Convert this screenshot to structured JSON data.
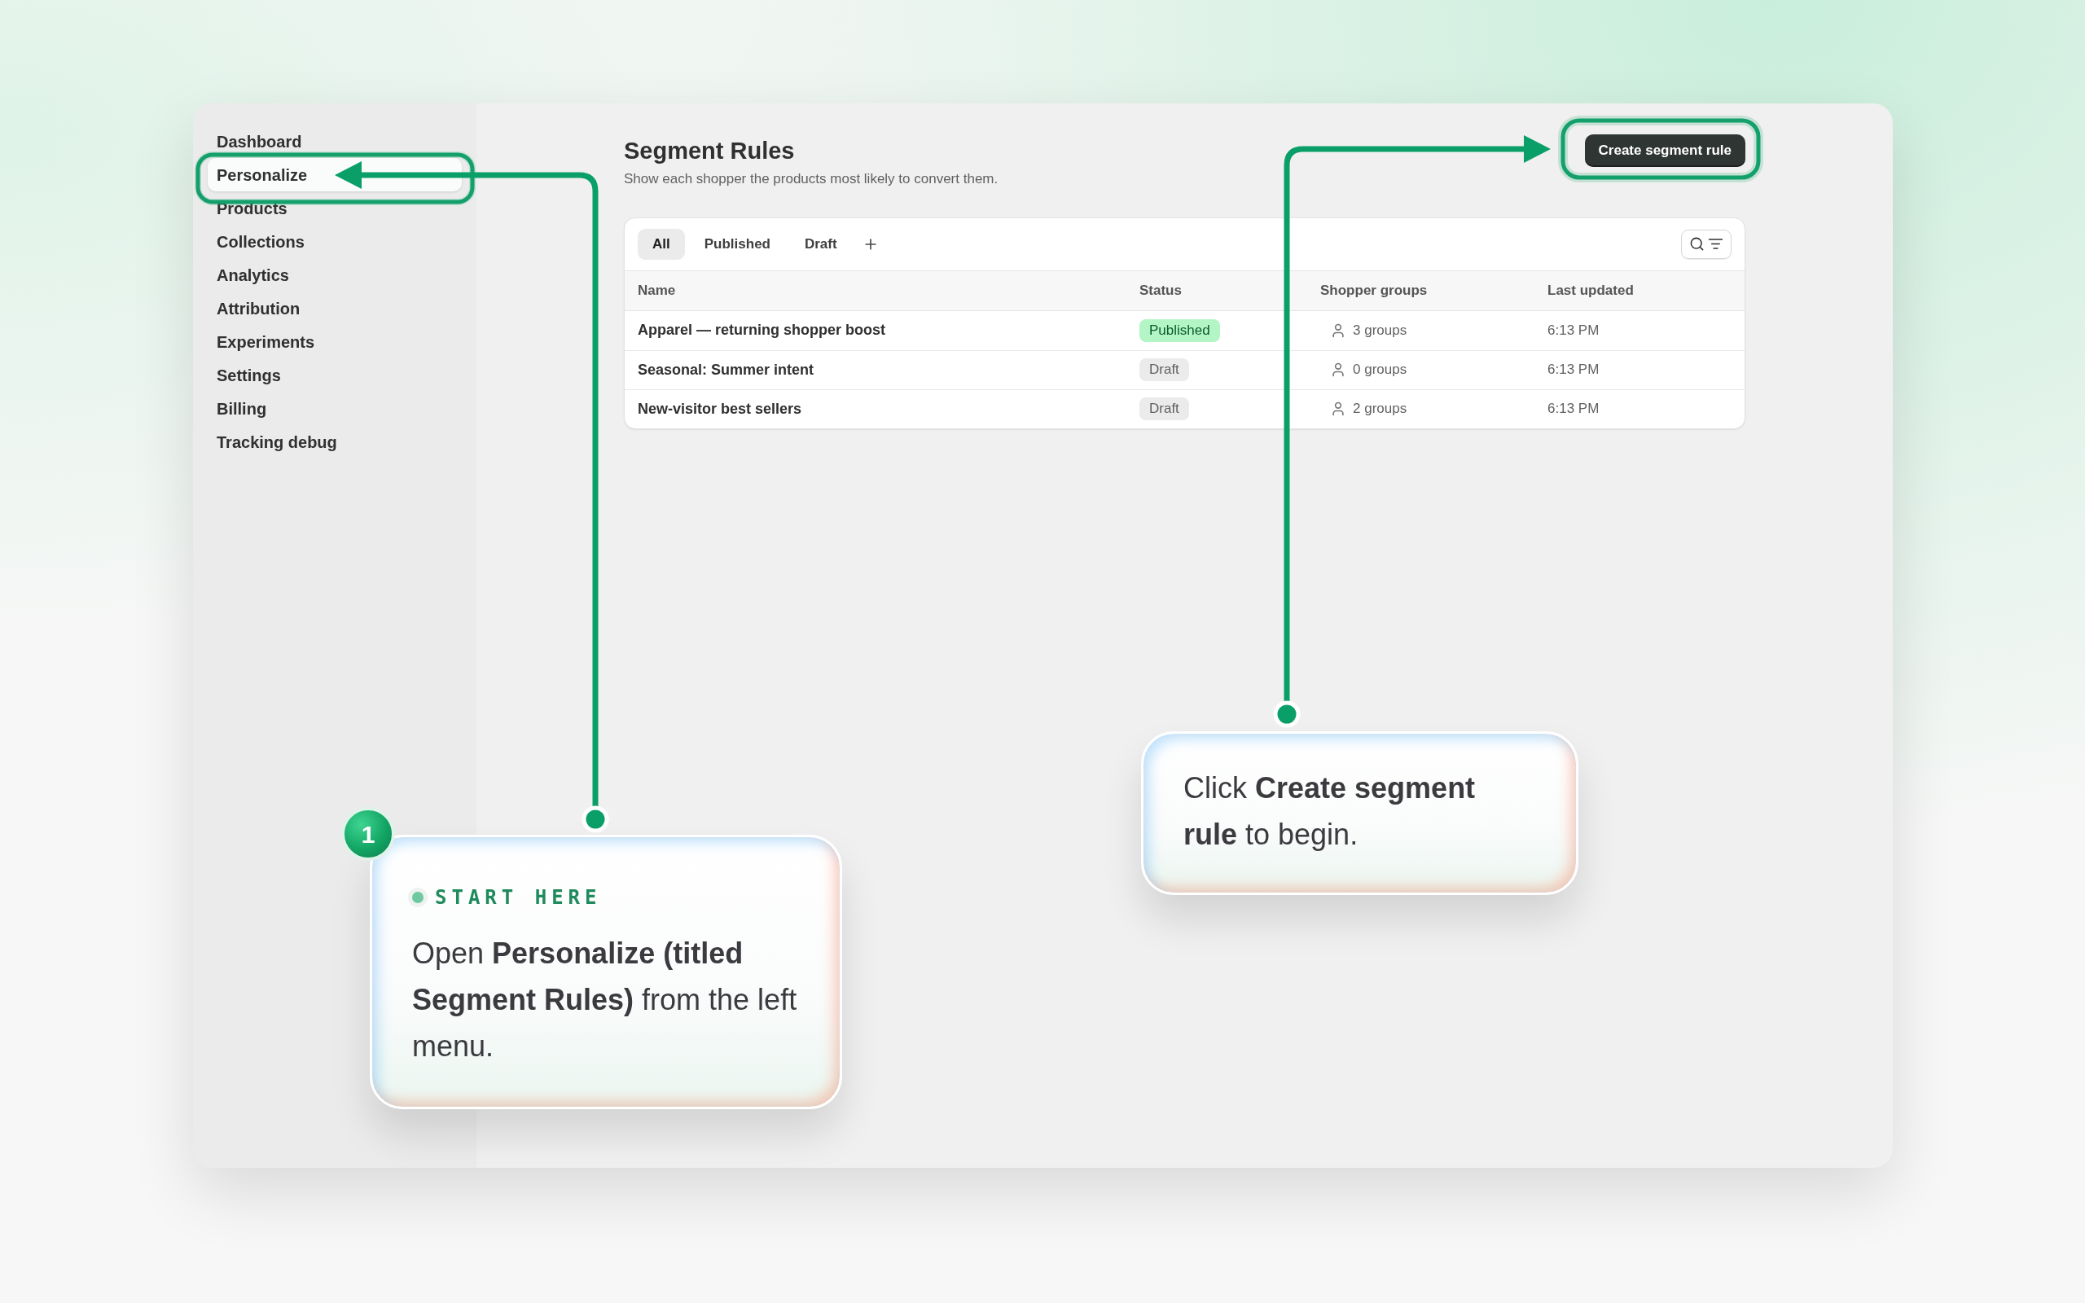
{
  "sidebar": {
    "items": [
      {
        "label": "Dashboard",
        "selected": false
      },
      {
        "label": "Personalize",
        "selected": true
      },
      {
        "label": "Products",
        "selected": false
      },
      {
        "label": "Collections",
        "selected": false
      },
      {
        "label": "Analytics",
        "selected": false
      },
      {
        "label": "Attribution",
        "selected": false
      },
      {
        "label": "Experiments",
        "selected": false
      },
      {
        "label": "Settings",
        "selected": false
      },
      {
        "label": "Billing",
        "selected": false
      },
      {
        "label": "Tracking debug",
        "selected": false
      }
    ]
  },
  "page": {
    "title": "Segment Rules",
    "subtitle": "Show each shopper the products most likely to convert them.",
    "primary_button": "Create segment rule"
  },
  "table": {
    "tabs": [
      {
        "label": "All",
        "selected": true
      },
      {
        "label": "Published",
        "selected": false
      },
      {
        "label": "Draft",
        "selected": false
      }
    ],
    "columns": [
      "Name",
      "Status",
      "Shopper groups",
      "Last updated"
    ],
    "rows": [
      {
        "name": "Apparel — returning shopper boost",
        "status": {
          "label": "Published",
          "kind": "success"
        },
        "groups": "3 groups",
        "updated": "6:13 PM"
      },
      {
        "name": "Seasonal: Summer intent",
        "status": {
          "label": "Draft",
          "kind": "neutral"
        },
        "groups": "0 groups",
        "updated": "6:13 PM"
      },
      {
        "name": "New-visitor best sellers",
        "status": {
          "label": "Draft",
          "kind": "neutral"
        },
        "groups": "2 groups",
        "updated": "6:13 PM"
      }
    ]
  },
  "callouts": [
    {
      "badge": "1",
      "eyebrow": "START HERE",
      "text": "Open **Personalize (titled Segment Rules)** from the left menu."
    },
    {
      "text": "Click **Create segment rule** to begin."
    }
  ]
}
